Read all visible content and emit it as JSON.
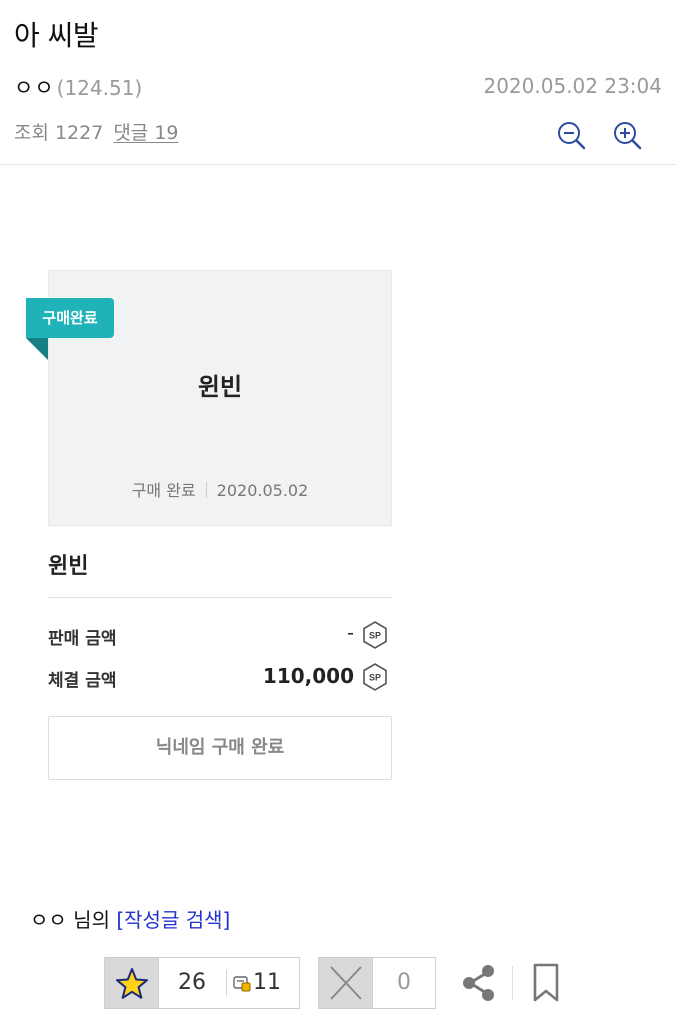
{
  "post": {
    "title": "아 씨발",
    "author": "ㅇㅇ",
    "ip": "(124.51)",
    "date": "2020.05.02 23:04",
    "views_label": "조회",
    "views": "1227",
    "comments_link": "댓글 19"
  },
  "card": {
    "badge": "구매완료",
    "nickname": "윈빈",
    "status": "구매 완료",
    "date": "2020.05.02"
  },
  "item": {
    "name": "윈빈",
    "sale_label": "판매 금액",
    "sale_amount": "-",
    "final_label": "체결 금액",
    "final_amount": "110,000",
    "currency": "SP",
    "button": "닉네임 구매 완료"
  },
  "author_search": {
    "author": "ㅇㅇ",
    "suffix": "님의",
    "link": "[작성글 검색]"
  },
  "actions": {
    "upvotes": "26",
    "fixed_upvotes": "11",
    "downvotes": "0"
  },
  "colors": {
    "badge": "#1fb3b9",
    "link": "#2233cc",
    "icon": "#2c4aa0"
  }
}
